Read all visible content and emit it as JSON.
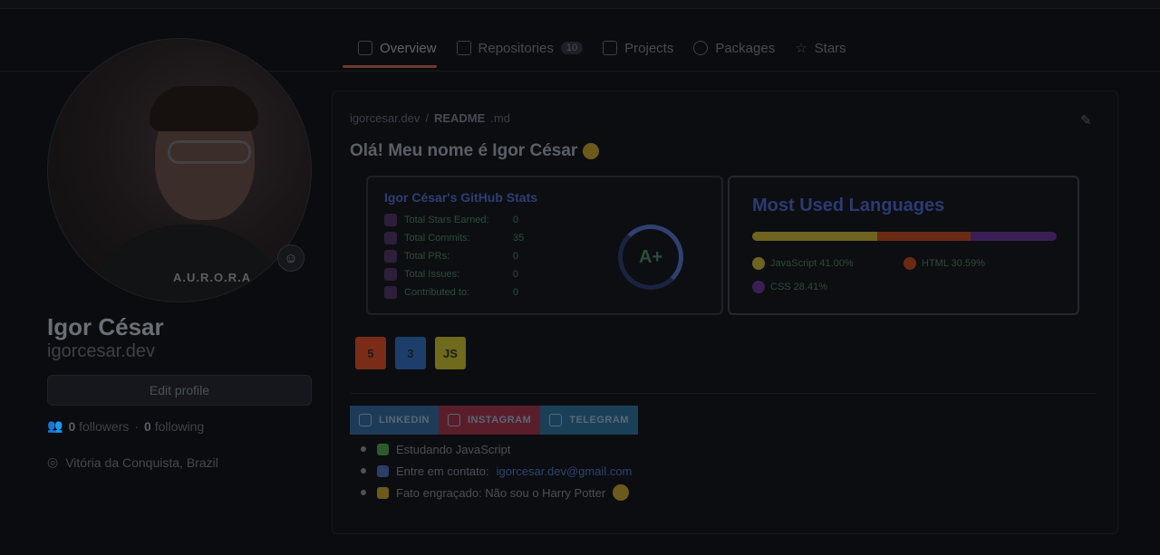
{
  "tabs": [
    {
      "label": "Overview",
      "active": true
    },
    {
      "label": "Repositories",
      "count": "10"
    },
    {
      "label": "Projects"
    },
    {
      "label": "Packages"
    },
    {
      "label": "Stars"
    }
  ],
  "profile": {
    "name": "Igor César",
    "username": "igorcesar.dev",
    "edit_label": "Edit profile",
    "followers_count": "0",
    "followers_label": "followers",
    "following_count": "0",
    "following_label": "following",
    "location": "Vitória da Conquista, Brazil",
    "shirt_text": "A.U.R.O.R.A"
  },
  "readme": {
    "path_user": "igorcesar.dev",
    "path_file": "README",
    "path_ext": ".md",
    "greeting": "Olá! Meu nome é Igor César"
  },
  "stats_card": {
    "title": "Igor César's GitHub Stats",
    "rows": [
      {
        "label": "Total Stars Earned:",
        "value": "0"
      },
      {
        "label": "Total Commits:",
        "value": "35"
      },
      {
        "label": "Total PRs:",
        "value": "0"
      },
      {
        "label": "Total Issues:",
        "value": "0"
      },
      {
        "label": "Contributed to:",
        "value": "0"
      }
    ],
    "rank": "A+"
  },
  "langs_card": {
    "title": "Most Used Languages",
    "languages": [
      {
        "label": "JavaScript 41.00%",
        "color": "#6e6420",
        "percent": 41.0
      },
      {
        "label": "HTML 30.59%",
        "color": "#6b2a14",
        "percent": 30.59
      },
      {
        "label": "CSS 28.41%",
        "color": "#3a1f55",
        "percent": 28.41
      }
    ]
  },
  "tech_icons": [
    {
      "label": "5",
      "name": "html5-icon",
      "color": "#7a2c18"
    },
    {
      "label": "3",
      "name": "css3-icon",
      "color": "#1d3e6b"
    },
    {
      "label": "JS",
      "name": "javascript-icon",
      "color": "#6f6a1c"
    }
  ],
  "badges": [
    {
      "label": "LINKEDIN",
      "name": "linkedin-badge",
      "color": "#1d3b58"
    },
    {
      "label": "INSTAGRAM",
      "name": "instagram-badge",
      "color": "#5a1e2a"
    },
    {
      "label": "TELEGRAM",
      "name": "telegram-badge",
      "color": "#1a4058"
    }
  ],
  "bullets": [
    {
      "text": "Estudando JavaScript",
      "icon_color": "#2d5a2c"
    },
    {
      "text": "Entre em contato:",
      "link": "igorcesar.dev@gmail.com",
      "icon_color": "#2b3e66"
    },
    {
      "text": "Fato engraçado: Não sou o Harry Potter",
      "icon_color": "#6b5a1c"
    }
  ]
}
